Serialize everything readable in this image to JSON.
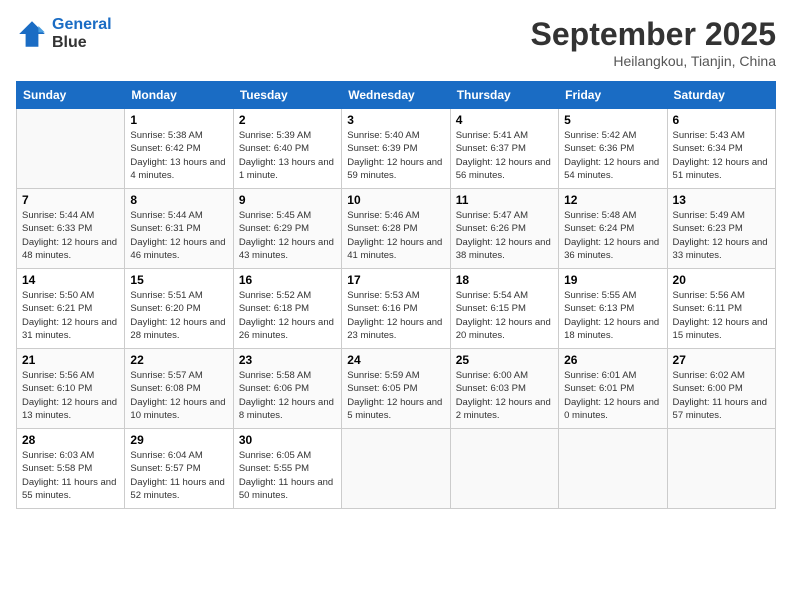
{
  "header": {
    "logo_line1": "General",
    "logo_line2": "Blue",
    "month": "September 2025",
    "location": "Heilangkou, Tianjin, China"
  },
  "weekdays": [
    "Sunday",
    "Monday",
    "Tuesday",
    "Wednesday",
    "Thursday",
    "Friday",
    "Saturday"
  ],
  "weeks": [
    [
      {
        "day": "",
        "sunrise": "",
        "sunset": "",
        "daylight": ""
      },
      {
        "day": "1",
        "sunrise": "Sunrise: 5:38 AM",
        "sunset": "Sunset: 6:42 PM",
        "daylight": "Daylight: 13 hours and 4 minutes."
      },
      {
        "day": "2",
        "sunrise": "Sunrise: 5:39 AM",
        "sunset": "Sunset: 6:40 PM",
        "daylight": "Daylight: 13 hours and 1 minute."
      },
      {
        "day": "3",
        "sunrise": "Sunrise: 5:40 AM",
        "sunset": "Sunset: 6:39 PM",
        "daylight": "Daylight: 12 hours and 59 minutes."
      },
      {
        "day": "4",
        "sunrise": "Sunrise: 5:41 AM",
        "sunset": "Sunset: 6:37 PM",
        "daylight": "Daylight: 12 hours and 56 minutes."
      },
      {
        "day": "5",
        "sunrise": "Sunrise: 5:42 AM",
        "sunset": "Sunset: 6:36 PM",
        "daylight": "Daylight: 12 hours and 54 minutes."
      },
      {
        "day": "6",
        "sunrise": "Sunrise: 5:43 AM",
        "sunset": "Sunset: 6:34 PM",
        "daylight": "Daylight: 12 hours and 51 minutes."
      }
    ],
    [
      {
        "day": "7",
        "sunrise": "Sunrise: 5:44 AM",
        "sunset": "Sunset: 6:33 PM",
        "daylight": "Daylight: 12 hours and 48 minutes."
      },
      {
        "day": "8",
        "sunrise": "Sunrise: 5:44 AM",
        "sunset": "Sunset: 6:31 PM",
        "daylight": "Daylight: 12 hours and 46 minutes."
      },
      {
        "day": "9",
        "sunrise": "Sunrise: 5:45 AM",
        "sunset": "Sunset: 6:29 PM",
        "daylight": "Daylight: 12 hours and 43 minutes."
      },
      {
        "day": "10",
        "sunrise": "Sunrise: 5:46 AM",
        "sunset": "Sunset: 6:28 PM",
        "daylight": "Daylight: 12 hours and 41 minutes."
      },
      {
        "day": "11",
        "sunrise": "Sunrise: 5:47 AM",
        "sunset": "Sunset: 6:26 PM",
        "daylight": "Daylight: 12 hours and 38 minutes."
      },
      {
        "day": "12",
        "sunrise": "Sunrise: 5:48 AM",
        "sunset": "Sunset: 6:24 PM",
        "daylight": "Daylight: 12 hours and 36 minutes."
      },
      {
        "day": "13",
        "sunrise": "Sunrise: 5:49 AM",
        "sunset": "Sunset: 6:23 PM",
        "daylight": "Daylight: 12 hours and 33 minutes."
      }
    ],
    [
      {
        "day": "14",
        "sunrise": "Sunrise: 5:50 AM",
        "sunset": "Sunset: 6:21 PM",
        "daylight": "Daylight: 12 hours and 31 minutes."
      },
      {
        "day": "15",
        "sunrise": "Sunrise: 5:51 AM",
        "sunset": "Sunset: 6:20 PM",
        "daylight": "Daylight: 12 hours and 28 minutes."
      },
      {
        "day": "16",
        "sunrise": "Sunrise: 5:52 AM",
        "sunset": "Sunset: 6:18 PM",
        "daylight": "Daylight: 12 hours and 26 minutes."
      },
      {
        "day": "17",
        "sunrise": "Sunrise: 5:53 AM",
        "sunset": "Sunset: 6:16 PM",
        "daylight": "Daylight: 12 hours and 23 minutes."
      },
      {
        "day": "18",
        "sunrise": "Sunrise: 5:54 AM",
        "sunset": "Sunset: 6:15 PM",
        "daylight": "Daylight: 12 hours and 20 minutes."
      },
      {
        "day": "19",
        "sunrise": "Sunrise: 5:55 AM",
        "sunset": "Sunset: 6:13 PM",
        "daylight": "Daylight: 12 hours and 18 minutes."
      },
      {
        "day": "20",
        "sunrise": "Sunrise: 5:56 AM",
        "sunset": "Sunset: 6:11 PM",
        "daylight": "Daylight: 12 hours and 15 minutes."
      }
    ],
    [
      {
        "day": "21",
        "sunrise": "Sunrise: 5:56 AM",
        "sunset": "Sunset: 6:10 PM",
        "daylight": "Daylight: 12 hours and 13 minutes."
      },
      {
        "day": "22",
        "sunrise": "Sunrise: 5:57 AM",
        "sunset": "Sunset: 6:08 PM",
        "daylight": "Daylight: 12 hours and 10 minutes."
      },
      {
        "day": "23",
        "sunrise": "Sunrise: 5:58 AM",
        "sunset": "Sunset: 6:06 PM",
        "daylight": "Daylight: 12 hours and 8 minutes."
      },
      {
        "day": "24",
        "sunrise": "Sunrise: 5:59 AM",
        "sunset": "Sunset: 6:05 PM",
        "daylight": "Daylight: 12 hours and 5 minutes."
      },
      {
        "day": "25",
        "sunrise": "Sunrise: 6:00 AM",
        "sunset": "Sunset: 6:03 PM",
        "daylight": "Daylight: 12 hours and 2 minutes."
      },
      {
        "day": "26",
        "sunrise": "Sunrise: 6:01 AM",
        "sunset": "Sunset: 6:01 PM",
        "daylight": "Daylight: 12 hours and 0 minutes."
      },
      {
        "day": "27",
        "sunrise": "Sunrise: 6:02 AM",
        "sunset": "Sunset: 6:00 PM",
        "daylight": "Daylight: 11 hours and 57 minutes."
      }
    ],
    [
      {
        "day": "28",
        "sunrise": "Sunrise: 6:03 AM",
        "sunset": "Sunset: 5:58 PM",
        "daylight": "Daylight: 11 hours and 55 minutes."
      },
      {
        "day": "29",
        "sunrise": "Sunrise: 6:04 AM",
        "sunset": "Sunset: 5:57 PM",
        "daylight": "Daylight: 11 hours and 52 minutes."
      },
      {
        "day": "30",
        "sunrise": "Sunrise: 6:05 AM",
        "sunset": "Sunset: 5:55 PM",
        "daylight": "Daylight: 11 hours and 50 minutes."
      },
      {
        "day": "",
        "sunrise": "",
        "sunset": "",
        "daylight": ""
      },
      {
        "day": "",
        "sunrise": "",
        "sunset": "",
        "daylight": ""
      },
      {
        "day": "",
        "sunrise": "",
        "sunset": "",
        "daylight": ""
      },
      {
        "day": "",
        "sunrise": "",
        "sunset": "",
        "daylight": ""
      }
    ]
  ]
}
